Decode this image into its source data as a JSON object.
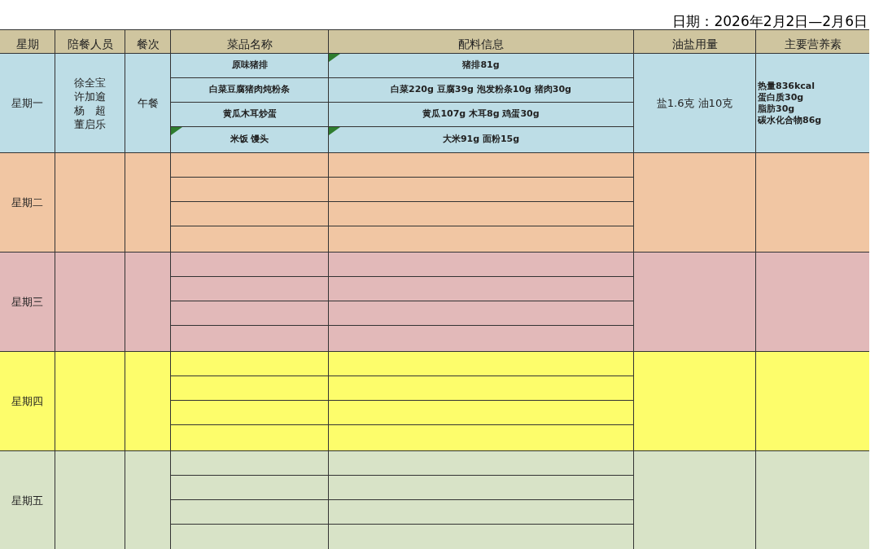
{
  "date_line": "日期：2026年2月2日—2月6日",
  "columns": [
    "星期",
    "陪餐人员",
    "餐次",
    "菜品名称",
    "配料信息",
    "油盐用量",
    "主要营养素"
  ],
  "days": [
    {
      "name": "星期一",
      "color": "#bddde6",
      "companions": [
        "徐全宝",
        "许加逾",
        "杨　超",
        "董启乐"
      ],
      "meal": "午餐",
      "dishes": [
        {
          "name": "原味猪排",
          "name_flag": false,
          "ingredients": "猪排81g",
          "ingredients_flag": true
        },
        {
          "name": "白菜豆腐猪肉炖粉条",
          "name_flag": false,
          "ingredients": "白菜220g 豆腐39g 泡发粉条10g 猪肉30g",
          "ingredients_flag": false
        },
        {
          "name": "黄瓜木耳炒蛋",
          "name_flag": false,
          "ingredients": "黄瓜107g 木耳8g 鸡蛋30g",
          "ingredients_flag": false
        },
        {
          "name": "米饭 馒头",
          "name_flag": true,
          "ingredients": "大米91g 面粉15g",
          "ingredients_flag": true
        }
      ],
      "oil_salt": "盐1.6克 油10克",
      "nutrients": [
        "热量836kcal",
        "蛋白质30g",
        "脂肪30g",
        "碳水化合物86g"
      ]
    },
    {
      "name": "星期二",
      "color": "#f1c6a3"
    },
    {
      "name": "星期三",
      "color": "#e2b9b9"
    },
    {
      "name": "星期四",
      "color": "#fdfd6b"
    },
    {
      "name": "星期五",
      "color": "#d8e3c7"
    }
  ]
}
